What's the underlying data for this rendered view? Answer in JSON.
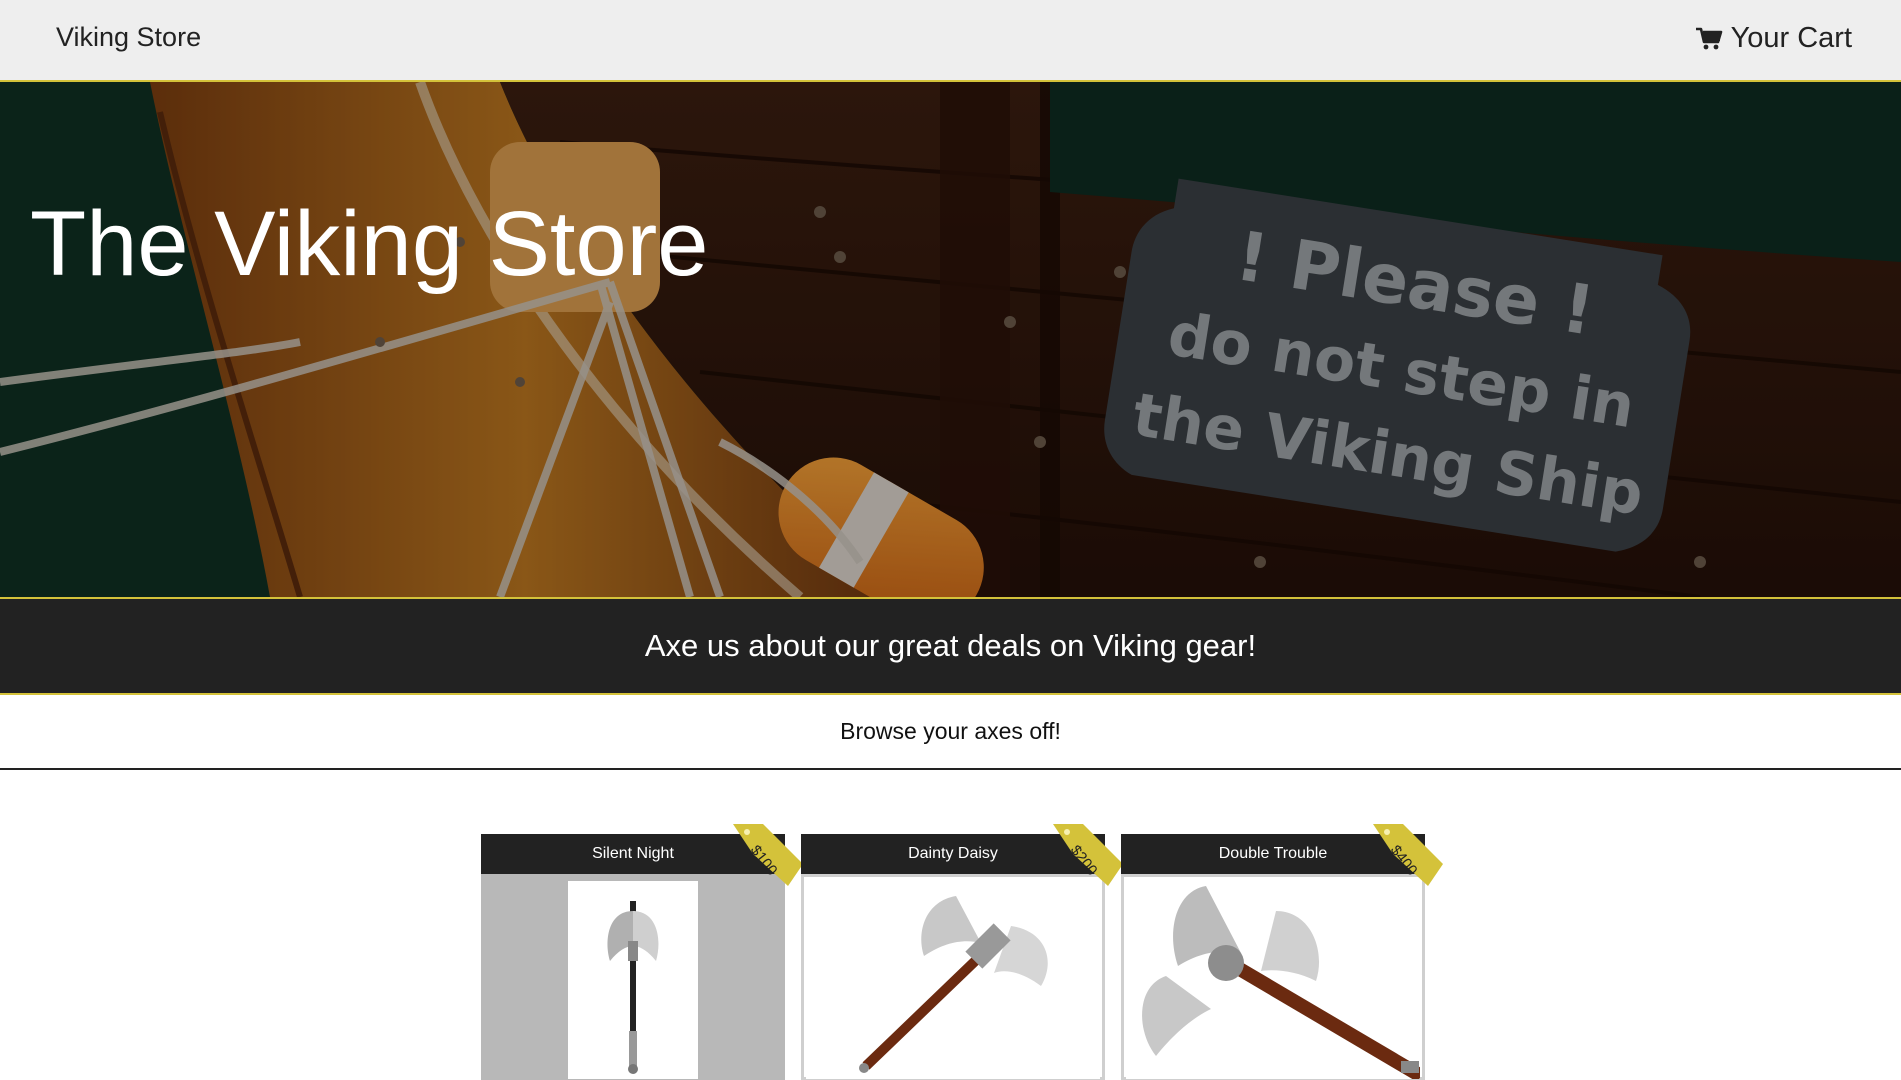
{
  "navbar": {
    "brand": "Viking Store",
    "cart_label": "Your Cart",
    "cart_icon": "shopping-cart-icon"
  },
  "hero": {
    "title": "The Viking Store",
    "sign_line1": "! Please !",
    "sign_line2": "do not step in",
    "sign_line3": "the Viking Ship"
  },
  "tagline": "Axe us about our great deals on Viking gear!",
  "browse": "Browse your axes off!",
  "colors": {
    "accent": "#d4c23a",
    "dark_band": "#222222",
    "navbar_bg": "#eeeeee"
  },
  "products": [
    {
      "name": "Silent Night",
      "price": "$100"
    },
    {
      "name": "Dainty Daisy",
      "price": "$200"
    },
    {
      "name": "Double Trouble",
      "price": "$400"
    }
  ]
}
